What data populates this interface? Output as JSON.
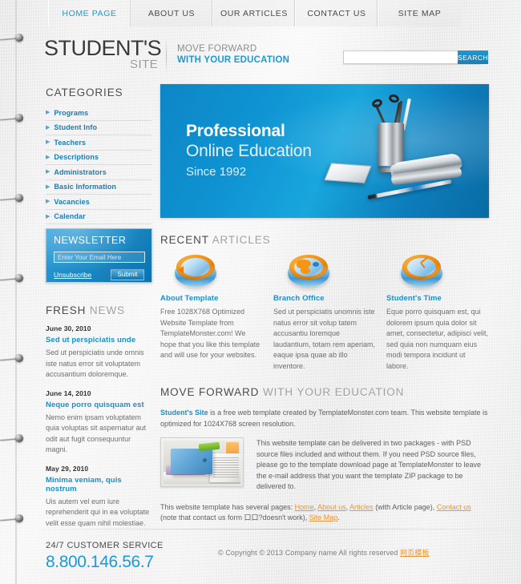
{
  "nav": {
    "items": [
      {
        "label": "HOME PAGE",
        "active": true
      },
      {
        "label": "ABOUT US",
        "active": false
      },
      {
        "label": "OUR ARTICLES",
        "active": false
      },
      {
        "label": "CONTACT US",
        "active": false
      },
      {
        "label": "SITE MAP",
        "active": false
      }
    ]
  },
  "header": {
    "logo_line1": "STUDENT'S",
    "logo_line2": "SITE",
    "tagline_line1": "MOVE FORWARD",
    "tagline_line2": "WITH YOUR EDUCATION",
    "search": {
      "value": "",
      "placeholder": "",
      "button_label": "SEARCH"
    }
  },
  "sidebar": {
    "categories_title": "CATEGORIES",
    "categories": [
      {
        "label": "Programs"
      },
      {
        "label": "Student Info"
      },
      {
        "label": "Teachers"
      },
      {
        "label": "Descriptions"
      },
      {
        "label": "Administrators"
      },
      {
        "label": "Basic Information"
      },
      {
        "label": "Vacancies"
      },
      {
        "label": "Calendar"
      }
    ],
    "newsletter": {
      "title": "NEWSLETTER",
      "email_value": "",
      "email_placeholder": "Enter Your Email Here",
      "unsubscribe_label": "Unsubscribe",
      "submit_label": "Submit"
    },
    "fresh_news": {
      "title_strong": "FRESH",
      "title_light": "NEWS",
      "items": [
        {
          "date": "June 30, 2010",
          "headline": "Sed ut perspiciatis unde",
          "body": "Sed ut perspiciatis unde omnis iste natus error sit voluptatem accusantium doloremque."
        },
        {
          "date": "June 14, 2010",
          "headline": "Neque porro quisquam est",
          "body": "Nemo enim ipsam voluptatem quia voluptas sit aspernatur aut odit aut fugit consequuntur magni."
        },
        {
          "date": "May 29, 2010",
          "headline": "Minima veniam, quis nostrum",
          "body": "Uis autem vel eum iure reprehenderit qui in ea voluptate velit esse quam nihil molestiae."
        }
      ]
    }
  },
  "banner": {
    "line1": "Professional",
    "line2": "Online Education",
    "line3": "Since 1992"
  },
  "recent_articles": {
    "title_strong": "RECENT",
    "title_light": "ARTICLES",
    "cards": [
      {
        "icon": "refresh-disc-icon",
        "title": "About Template",
        "body": "Free 1028X768 Optimized Website Template from TemplateMonster.com! We hope that you like this template and will use for your websites."
      },
      {
        "icon": "globe-disc-icon",
        "title": "Branch Office",
        "body": "Sed ut perspiciatis unomnis iste natus error sit volup tatem accusantiu loremque laudantium, totam rem aperiam, eaque ipsa quae ab illo inventore."
      },
      {
        "icon": "clock-disc-icon",
        "title": "Student's Time",
        "body": "Eque porro quisquam est, qui dolorem ipsum quia dolor sit amet, consectetur, adipisci velit, sed quia non numquam eius modi tempora incidunt ut labore."
      }
    ]
  },
  "move_forward": {
    "title_strong": "MOVE FORWARD",
    "title_light": "WITH YOUR EDUCATION",
    "intro_brand": "Student's Site",
    "intro_text": " is a free web template created by TemplateMonster.com team. This website template is optimized for 1024X768 screen resolution.",
    "image_name": "binders-and-papers-photo",
    "paragraph": "This website template can be delivered in two packages - with PSD source files included and without them. If you need PSD source files, please go to the template download page at TemplateMonster to leave the e-mail address that you want the template ZIP package to be delivered to.",
    "footer_prefix": "This website template has several pages: ",
    "links": [
      {
        "label": "Home"
      },
      {
        "label": "About us"
      },
      {
        "label": "Articles"
      },
      {
        "label": "Contact us"
      },
      {
        "label": "Site Map"
      }
    ],
    "footer_mid1": ", ",
    "footer_mid2": ", ",
    "footer_mid3": " (with Article page), ",
    "footer_mid4": " (note that contact us form 口口?doesn't work), ",
    "footer_end": "."
  },
  "footer": {
    "service_label": "24/7 CUSTOMER SERVICE",
    "phone": "8.800.146.56.7",
    "copyright": "© Copyright © 2013 Company name All rights reserved ",
    "copyright_link": "网页模板"
  },
  "colors": {
    "accent_blue": "#1b9ad6",
    "link_blue": "#1b8fcc",
    "link_orange": "#f0942c",
    "text_dark": "#4a4a4a",
    "text_grey": "#6f6f6f"
  }
}
